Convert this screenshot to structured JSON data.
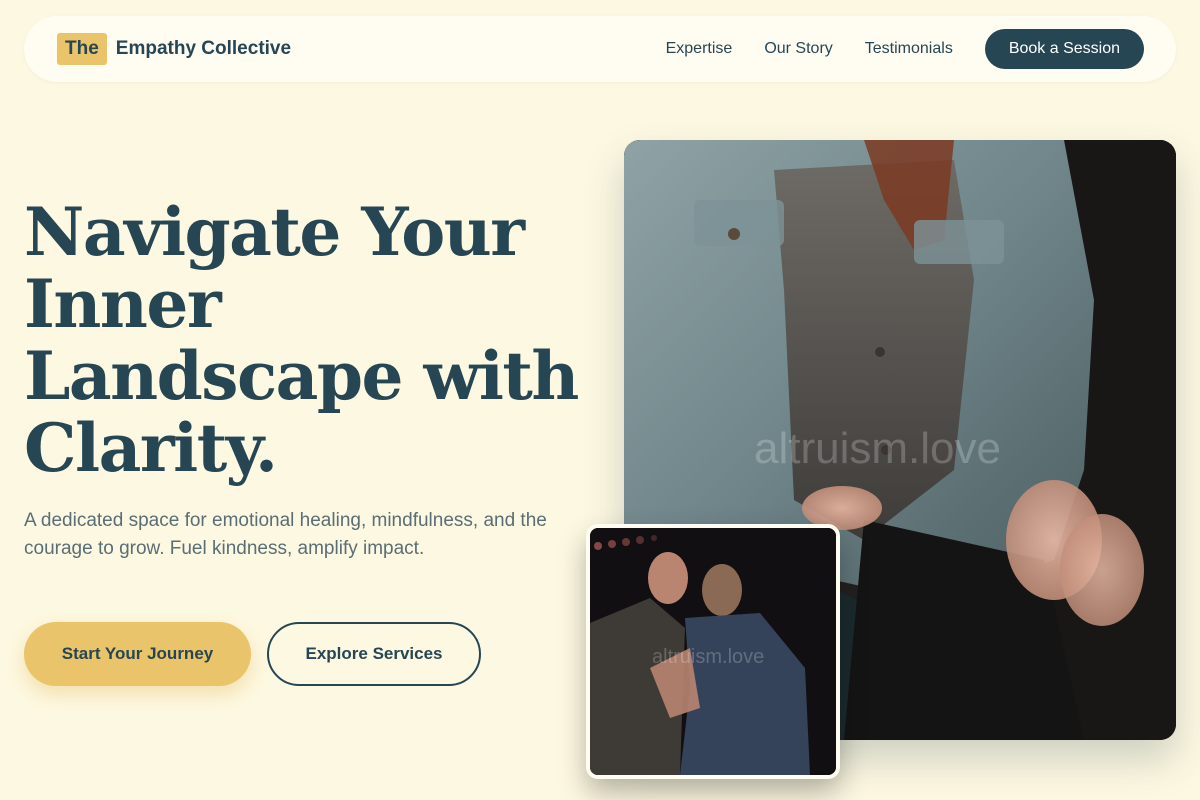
{
  "nav": {
    "brand_mark": "The",
    "brand_name": "Empathy Collective",
    "links": [
      "Expertise",
      "Our Story",
      "Testimonials"
    ],
    "cta_label": "Book a Session"
  },
  "hero": {
    "title_lines": [
      "Navigate Your",
      "Inner",
      "Landscape with",
      "Clarity."
    ],
    "subtitle": "A dedicated space for emotional healing, mindfulness, and the courage to grow. Fuel kindness, amplify impact.",
    "primary_button": "Start Your Journey",
    "secondary_button": "Explore Services"
  },
  "images": {
    "main_watermark": "altruism.love",
    "secondary_watermark": "altruism.love"
  },
  "colors": {
    "background": "#fdf8e1",
    "primary": "#264653",
    "accent": "#e9c46a"
  }
}
